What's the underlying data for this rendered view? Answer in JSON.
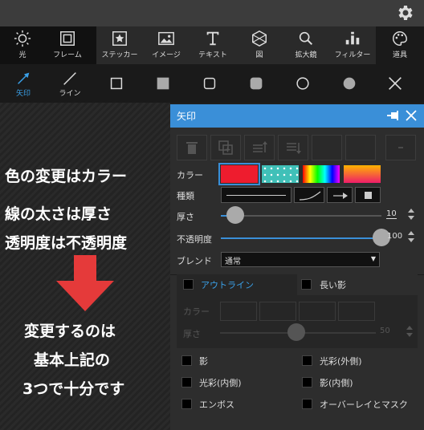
{
  "toolbar": {
    "tools": [
      {
        "label": "光",
        "icon": "sun-icon"
      },
      {
        "label": "フレーム",
        "icon": "frame-icon"
      },
      {
        "label": "ステッカー",
        "icon": "sticker-icon"
      },
      {
        "label": "イメージ",
        "icon": "image-icon"
      },
      {
        "label": "テキスト",
        "icon": "text-icon"
      },
      {
        "label": "図",
        "icon": "shape-icon"
      },
      {
        "label": "拡大鏡",
        "icon": "magnifier-icon"
      },
      {
        "label": "フィルター",
        "icon": "filter-icon"
      },
      {
        "label": "道具",
        "icon": "palette-icon"
      }
    ]
  },
  "subtoolbar": {
    "arrow_label": "矢印",
    "line_label": "ライン"
  },
  "annotation": {
    "line1": "色の変更はカラー",
    "line2": "線の太さは厚さ",
    "line3": "透明度は不透明度",
    "line4": "変更するのは",
    "line5": "基本上記の",
    "line6": "3つで十分です"
  },
  "panel": {
    "title": "矢印",
    "color_label": "カラー",
    "type_label": "種類",
    "thickness_label": "厚さ",
    "thickness_value": "10",
    "thickness_level": 0.09,
    "opacity_label": "不透明度",
    "opacity_value": "100",
    "opacity_level": 1.0,
    "blend_label": "ブレンド",
    "blend_value": "通常",
    "outline_label": "アウトライン",
    "long_shadow_label": "長い影",
    "ghost_color_label": "カラー",
    "ghost_thickness_label": "厚さ",
    "ghost_thickness_value": "50",
    "effects": {
      "shadow": "影",
      "outer_glow": "光彩(外側)",
      "inner_glow": "光彩(内側)",
      "inner_shadow": "影(内側)",
      "emboss": "エンボス",
      "overlay_mask": "オーバーレイとマスク"
    },
    "colors": {
      "red": "#ee1c2e",
      "teal": "#40c0b8",
      "accent": "#3a8fd8"
    }
  }
}
